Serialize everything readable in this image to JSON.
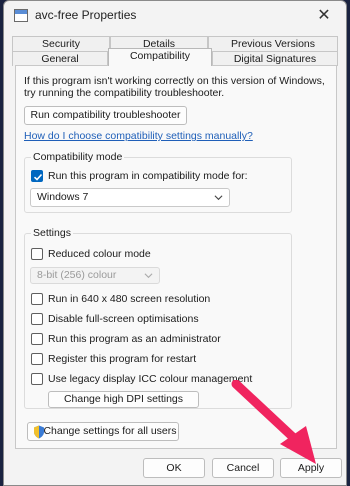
{
  "window": {
    "title": "avc-free Properties",
    "close_glyph": "✕"
  },
  "tabs": {
    "row1": [
      "Security",
      "Details",
      "Previous Versions"
    ],
    "row2": [
      "General",
      "Compatibility",
      "Digital Signatures"
    ],
    "active": "Compatibility"
  },
  "intro": {
    "line1": "If this program isn't working correctly on this version of Windows,",
    "line2": "try running the compatibility troubleshooter."
  },
  "troubleshooter_button": "Run compatibility troubleshooter",
  "manual_link": "How do I choose compatibility settings manually?",
  "compat_mode": {
    "legend": "Compatibility mode",
    "checkbox_label": "Run this program in compatibility mode for:",
    "checked": true,
    "selected_os": "Windows 7"
  },
  "settings": {
    "legend": "Settings",
    "reduced_colour": {
      "label": "Reduced colour mode",
      "checked": false
    },
    "colour_select": "8-bit (256) colour",
    "options": [
      {
        "label": "Run in 640 x 480 screen resolution",
        "checked": false
      },
      {
        "label": "Disable full-screen optimisations",
        "checked": false
      },
      {
        "label": "Run this program as an administrator",
        "checked": false
      },
      {
        "label": "Register this program for restart",
        "checked": false
      },
      {
        "label": "Use legacy display ICC colour management",
        "checked": false
      }
    ],
    "dpi_button": "Change high DPI settings"
  },
  "all_users_button": "Change settings for all users",
  "footer": {
    "ok": "OK",
    "cancel": "Cancel",
    "apply": "Apply"
  },
  "colors": {
    "accent": "#0067c0",
    "arrow": "#f0245f"
  },
  "icons": [
    "app-icon",
    "close-icon",
    "checkmark-icon",
    "chevron-down-icon",
    "shield-icon",
    "arrow-annotation"
  ]
}
